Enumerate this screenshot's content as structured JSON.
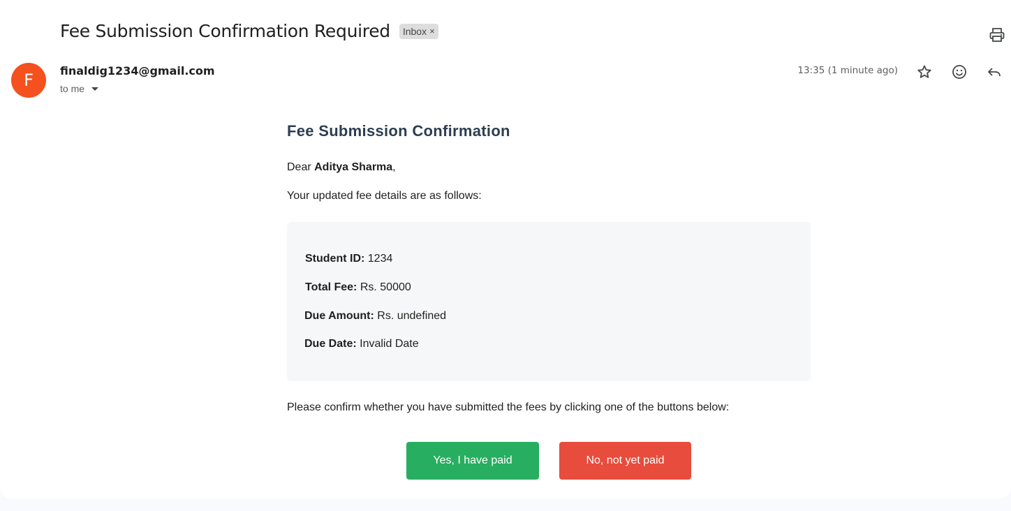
{
  "email": {
    "subject": "Fee Submission Confirmation Required",
    "label": "Inbox",
    "label_remove": "×",
    "sender_initial": "F",
    "sender": "finaldig1234@gmail.com",
    "recipient": "to me",
    "timestamp": "13:35 (1 minute ago)"
  },
  "body": {
    "title": "Fee Submission Confirmation",
    "greeting_prefix": "Dear ",
    "student_name": "Aditya Sharma",
    "greeting_suffix": ",",
    "intro": "Your updated fee details are as follows:",
    "details": [
      {
        "label": "Student ID:",
        "value": " 1234"
      },
      {
        "label": "Total Fee:",
        "value": " Rs. 50000"
      },
      {
        "label": "Due Amount:",
        "value": " Rs. undefined"
      },
      {
        "label": "Due Date:",
        "value": " Invalid Date"
      }
    ],
    "confirm_text": "Please confirm whether you have submitted the fees by clicking one of the buttons below:",
    "yes_button": "Yes, I have paid",
    "no_button": "No, not yet paid"
  },
  "icons": {
    "print": "printer-icon",
    "star": "star-icon",
    "emoji": "emoji-icon",
    "reply": "reply-icon",
    "caret": "chevron-down-icon"
  },
  "colors": {
    "avatar": "#f4511e",
    "title": "#2c3e50",
    "yes_button": "#27ae60",
    "no_button": "#e74c3c",
    "details_bg": "#f6f7f9"
  }
}
